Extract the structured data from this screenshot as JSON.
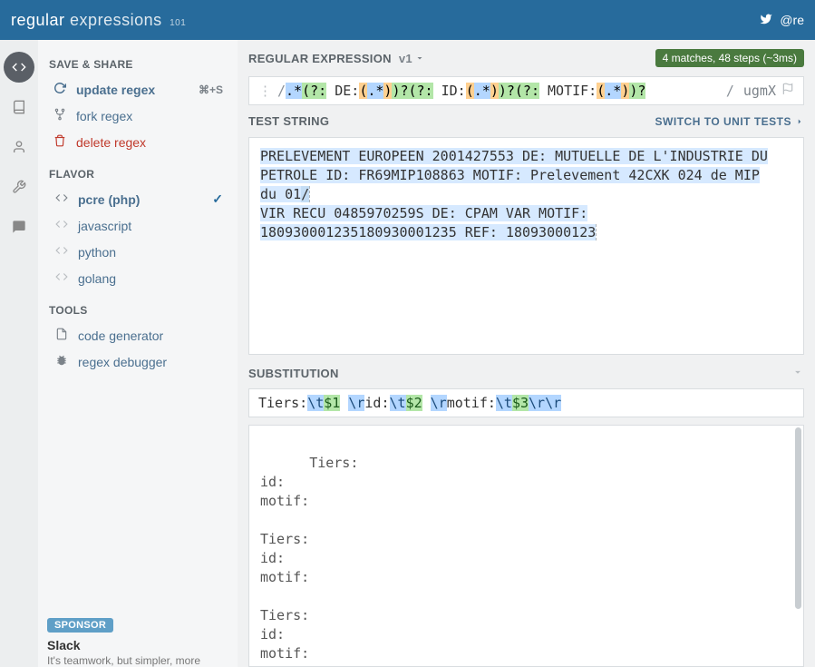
{
  "topbar": {
    "logo_bold": "regular",
    "logo_light": "expressions",
    "logo_sub": "101",
    "twitter_handle": "@re"
  },
  "sidebar": {
    "save_share_label": "SAVE & SHARE",
    "update_regex": "update regex",
    "update_shortcut": "⌘+S",
    "fork_regex": "fork regex",
    "delete_regex": "delete regex",
    "flavor_label": "FLAVOR",
    "flavors": [
      {
        "label": "pcre (php)",
        "selected": true
      },
      {
        "label": "javascript",
        "selected": false
      },
      {
        "label": "python",
        "selected": false
      },
      {
        "label": "golang",
        "selected": false
      }
    ],
    "tools_label": "TOOLS",
    "tools": [
      {
        "label": "code generator"
      },
      {
        "label": "regex debugger"
      }
    ],
    "sponsor_badge": "SPONSOR",
    "sponsor_title": "Slack",
    "sponsor_desc": "It's teamwork, but simpler, more"
  },
  "main": {
    "regex_header": "REGULAR EXPRESSION",
    "version": "v1",
    "match_info": "4 matches, 48 steps (~3ms)",
    "regex_tokens": [
      {
        "t": ".*",
        "cls": "tok-bg-blue"
      },
      {
        "t": "(?:",
        "cls": "tok-bg-green"
      },
      {
        "t": " DE:",
        "cls": "tok-text"
      },
      {
        "t": "(",
        "cls": "tok-bg-orange"
      },
      {
        "t": ".*",
        "cls": "tok-bg-blue"
      },
      {
        "t": ")",
        "cls": "tok-bg-orange"
      },
      {
        "t": ")?",
        "cls": "tok-bg-green"
      },
      {
        "t": "(?:",
        "cls": "tok-bg-green"
      },
      {
        "t": " ID:",
        "cls": "tok-text"
      },
      {
        "t": "(",
        "cls": "tok-bg-orange"
      },
      {
        "t": ".*",
        "cls": "tok-bg-blue"
      },
      {
        "t": ")",
        "cls": "tok-bg-orange"
      },
      {
        "t": ")?",
        "cls": "tok-bg-green"
      },
      {
        "t": "(?:",
        "cls": "tok-bg-green"
      },
      {
        "t": " MOTIF:",
        "cls": "tok-text"
      },
      {
        "t": "(",
        "cls": "tok-bg-orange"
      },
      {
        "t": ".*",
        "cls": "tok-bg-blue"
      },
      {
        "t": ")",
        "cls": "tok-bg-orange"
      },
      {
        "t": ")?",
        "cls": "tok-bg-green"
      }
    ],
    "regex_flags": "ugmX",
    "test_header": "TEST STRING",
    "unit_tests_link": "SWITCH TO UNIT TESTS",
    "test_string_lines": [
      {
        "pre": "",
        "hl": "PRELEVEMENT EUROPEEN 2001427553 DE: MUTUELLE DE L'INDUSTRIE DU "
      },
      {
        "pre": "",
        "hl": "PETROLE ID: FR69MIP108863 MOTIF: Prelevement 42CXK 024 de MIP "
      },
      {
        "pre": "",
        "hl": "du 01",
        "hl2": "/"
      },
      {
        "pre": "",
        "hl": "VIR RECU    0485970259S DE: CPAM VAR MOTIF: "
      },
      {
        "pre": "",
        "hl": "180930001235180930001235 REF: 18093000123"
      }
    ],
    "substitution_header": "SUBSTITUTION",
    "substitution_tokens": [
      {
        "t": "Tiers:",
        "cls": "tok-text"
      },
      {
        "t": "\\t",
        "cls": "hl-esc"
      },
      {
        "t": "$1",
        "cls": "hl-ref"
      },
      {
        "t": " ",
        "cls": "tok-text"
      },
      {
        "t": "\\r",
        "cls": "hl-esc"
      },
      {
        "t": "id:",
        "cls": "tok-text"
      },
      {
        "t": "\\t",
        "cls": "hl-esc"
      },
      {
        "t": "$2",
        "cls": "hl-ref"
      },
      {
        "t": " ",
        "cls": "tok-text"
      },
      {
        "t": "\\r",
        "cls": "hl-esc"
      },
      {
        "t": "motif:",
        "cls": "tok-text"
      },
      {
        "t": "\\t",
        "cls": "hl-esc"
      },
      {
        "t": "$3",
        "cls": "hl-ref"
      },
      {
        "t": "\\r",
        "cls": "hl-esc"
      },
      {
        "t": "\\r",
        "cls": "hl-esc"
      }
    ],
    "result_text": "Tiers:\t\nid:\t\nmotif:\t\n\nTiers:\t\nid:\t\nmotif:\t\n\nTiers:\t\nid:\t\nmotif:\t"
  }
}
